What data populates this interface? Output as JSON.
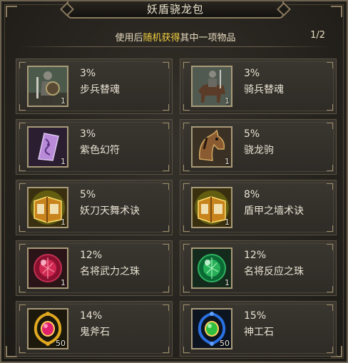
{
  "title": "妖盾骁龙包",
  "subtitle": {
    "prefix": "使用后",
    "highlight": "随机获得",
    "suffix": "其中一项物品"
  },
  "page": "1/2",
  "items": [
    {
      "percent": "3%",
      "name": "步兵替魂",
      "qty": "1",
      "icon": "infantry-soldier-icon"
    },
    {
      "percent": "3%",
      "name": "骑兵替魂",
      "qty": "1",
      "icon": "cavalry-soldier-icon"
    },
    {
      "percent": "3%",
      "name": "紫色幻符",
      "qty": "1",
      "icon": "purple-talisman-icon"
    },
    {
      "percent": "5%",
      "name": "骁龙驹",
      "qty": "1",
      "icon": "warhorse-icon"
    },
    {
      "percent": "5%",
      "name": "妖刀天舞术诀",
      "qty": "1",
      "icon": "skill-book-icon"
    },
    {
      "percent": "8%",
      "name": "盾甲之墙术诀",
      "qty": "1",
      "icon": "skill-book-icon"
    },
    {
      "percent": "12%",
      "name": "名将武力之珠",
      "qty": "1",
      "icon": "red-orb-icon"
    },
    {
      "percent": "12%",
      "name": "名将反应之珠",
      "qty": "1",
      "icon": "green-orb-icon"
    },
    {
      "percent": "14%",
      "name": "鬼斧石",
      "qty": "50",
      "icon": "red-gem-amulet-icon"
    },
    {
      "percent": "15%",
      "name": "神工石",
      "qty": "50",
      "icon": "blue-gem-amulet-icon"
    }
  ],
  "colors": {
    "highlight": "#f2d040",
    "text": "#e8e2d2",
    "frame": "#8a7a5e"
  }
}
